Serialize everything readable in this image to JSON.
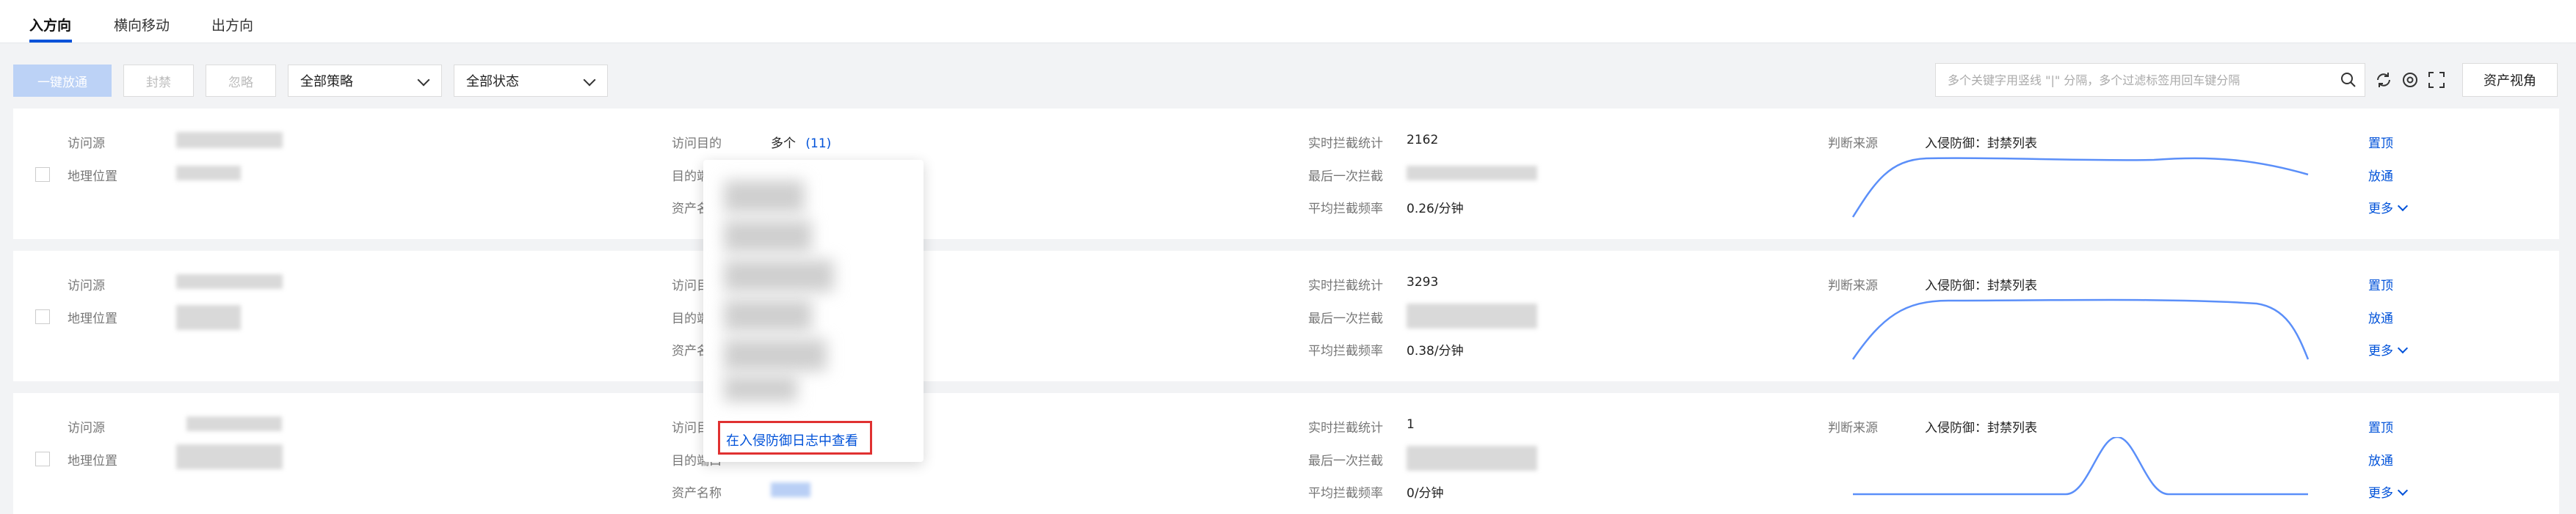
{
  "tabs": [
    {
      "label": "入方向",
      "active": true
    },
    {
      "label": "横向移动",
      "active": false
    },
    {
      "label": "出方向",
      "active": false
    }
  ],
  "toolbar": {
    "one_click_allow": "一键放通",
    "block": "封禁",
    "ignore": "忽略",
    "policy_select": "全部策略",
    "status_select": "全部状态",
    "search_placeholder": "多个关键字用竖线 \"|\" 分隔，多个过滤标签用回车键分隔",
    "asset_view": "资产视角"
  },
  "labels": {
    "source": "访问源",
    "geo": "地理位置",
    "dest": "访问目的",
    "dest_port": "目的端口",
    "asset_name": "资产名称",
    "realtime_stats": "实时拦截统计",
    "last_block": "最后一次拦截",
    "avg_rate": "平均拦截频率",
    "judge_source": "判断来源"
  },
  "rows": [
    {
      "dest_value": "多个",
      "dest_count": "(11)",
      "realtime": "2162",
      "rate": "0.26/分钟",
      "judge": "入侵防御：封禁列表",
      "pin": "置顶",
      "allow": "放通",
      "more": "更多"
    },
    {
      "realtime": "3293",
      "rate": "0.38/分钟",
      "judge": "入侵防御：封禁列表",
      "pin": "置顶",
      "allow": "放通",
      "more": "更多"
    },
    {
      "realtime": "1",
      "rate": "0/分钟",
      "judge": "入侵防御：封禁列表",
      "pin": "置顶",
      "allow": "放通",
      "more": "更多"
    }
  ],
  "popover": {
    "link": "在入侵防御日志中查看"
  },
  "colors": {
    "accent": "#0052d9",
    "sparkline": "#5b8ff9",
    "highlight_box": "#e03131"
  }
}
